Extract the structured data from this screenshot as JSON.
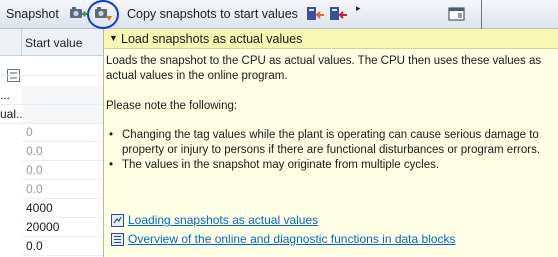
{
  "toolbar": {
    "title": "Snapshot",
    "copy_label": "Copy snapshots to start values",
    "more_arrow": "▸"
  },
  "table": {
    "header_start_value": "Start value",
    "rows": [
      {
        "left": "",
        "value": "",
        "grey": false
      },
      {
        "left": "...",
        "value": "",
        "grey": false
      },
      {
        "left": "ual...",
        "value": "",
        "grey": false
      },
      {
        "left": "",
        "value": "0",
        "grey": true
      },
      {
        "left": "",
        "value": "0.0",
        "grey": true
      },
      {
        "left": "",
        "value": "0.0",
        "grey": true
      },
      {
        "left": "",
        "value": "0.0",
        "grey": true
      },
      {
        "left": "",
        "value": "4000",
        "grey": false
      },
      {
        "left": "",
        "value": "20000",
        "grey": false
      },
      {
        "left": "",
        "value": "0.0",
        "grey": false
      }
    ]
  },
  "tooltip": {
    "title": "Load snapshots as actual values",
    "para1": "Loads the snapshot to the CPU as actual values. The CPU then uses these values as actual values in the online program.",
    "para2": "Please note the following:",
    "bullet1": "Changing the tag values while the plant is operating can cause serious damage to property or injury to persons if there are functional disturbances or program errors.",
    "bullet2": "The values in the snapshot may originate from multiple cycles.",
    "link1": "Loading snapshots as actual values",
    "link2": "Overview of the online and diagnostic functions in data blocks"
  },
  "colors": {
    "highlight_circle": "#0a3bd6",
    "tooltip_bg": "#ffffe6",
    "tooltip_header": "#f7f7b4",
    "link": "#0066cc"
  },
  "icons": [
    "snapshot-green-icon",
    "load-snapshot-icon",
    "copy-start-values-icon",
    "copy-start-values-alt-icon",
    "panel-icon",
    "list-icon",
    "help-link-icon",
    "book-link-icon"
  ]
}
